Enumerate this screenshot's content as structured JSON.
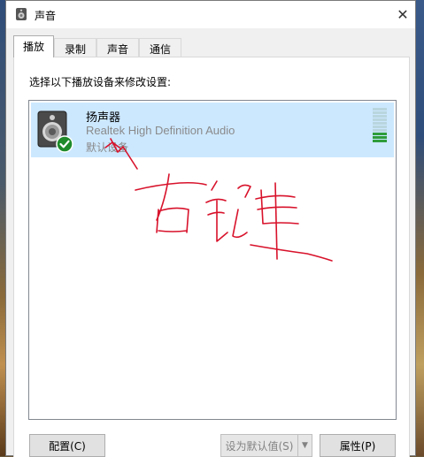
{
  "window": {
    "title": "声音",
    "close_glyph": "✕"
  },
  "tabs": [
    {
      "label": "播放",
      "active": true
    },
    {
      "label": "录制",
      "active": false
    },
    {
      "label": "声音",
      "active": false
    },
    {
      "label": "通信",
      "active": false
    }
  ],
  "instruction": "选择以下播放设备来修改设置:",
  "devices": [
    {
      "name": "扬声器",
      "description": "Realtek High Definition Audio",
      "status": "默认设备",
      "icon": "speaker-icon",
      "default_badge_icon": "check-badge-icon",
      "level_fraction": 0.3,
      "selected": true
    }
  ],
  "annotation": {
    "handwritten_text": "右键"
  },
  "buttons": {
    "configure": "配置(C)",
    "set_default": "设为默认值(S)",
    "properties": "属性(P)"
  },
  "colors": {
    "selection": "#cce8ff",
    "meter_on": "#2e9c3a",
    "annotation_ink": "#d8122b"
  }
}
